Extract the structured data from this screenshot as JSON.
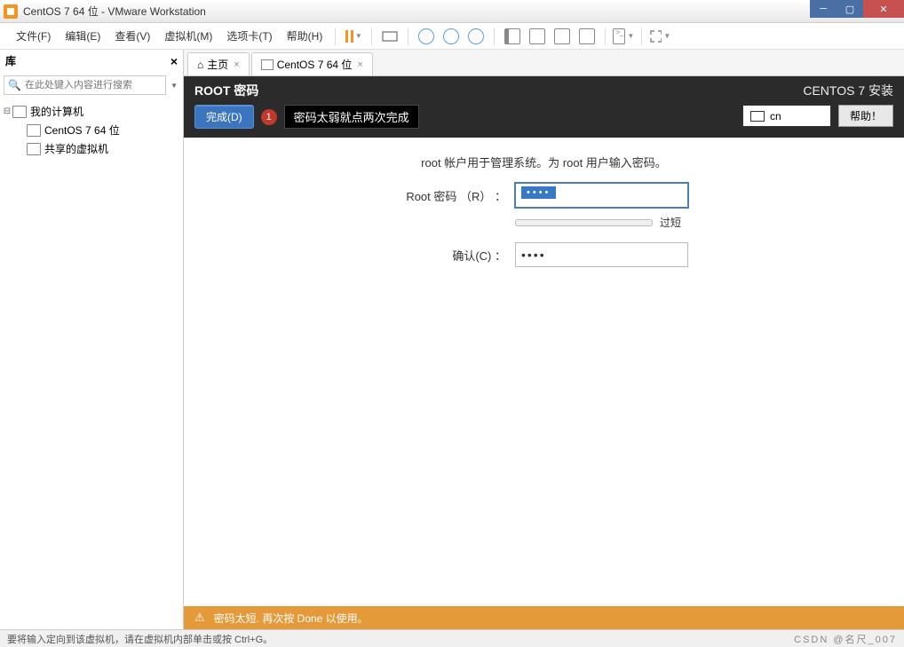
{
  "window": {
    "title": "CentOS 7 64 位 - VMware Workstation"
  },
  "menu": {
    "file": "文件(F)",
    "edit": "编辑(E)",
    "view": "查看(V)",
    "vm": "虚拟机(M)",
    "tabs": "选项卡(T)",
    "help": "帮助(H)"
  },
  "sidebar": {
    "title": "库",
    "search_placeholder": "在此处键入内容进行搜索",
    "items": {
      "my_computer": "我的计算机",
      "centos": "CentOS 7 64 位",
      "shared": "共享的虚拟机"
    }
  },
  "tabs": {
    "home": "主页",
    "vm": "CentOS 7 64 位"
  },
  "anaconda": {
    "header_title": "ROOT 密码",
    "done_btn": "完成(D)",
    "badge": "1",
    "tip": "密码太弱就点两次完成",
    "install_title": "CENTOS 7 安装",
    "kbd": "cn",
    "help_btn": "帮助！",
    "description": "root 帐户用于管理系统。为 root 用户输入密码。",
    "root_label": "Root 密码 （R） ：",
    "confirm_label": "确认(C) ：",
    "password_value": "••••",
    "confirm_value": "••••",
    "strength_text": "过短",
    "warning": "密码太短. 再次按 Done 以使用。"
  },
  "statusbar": {
    "text": "要将输入定向到该虚拟机，请在虚拟机内部单击或按 Ctrl+G。",
    "watermark": "CSDN @名尺_007"
  }
}
